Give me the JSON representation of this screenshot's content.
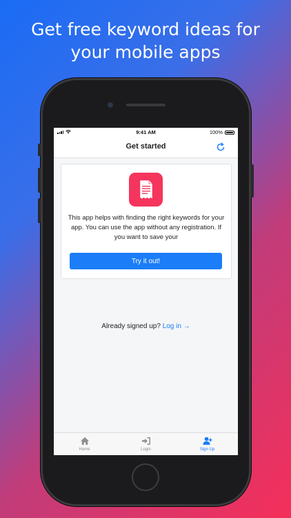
{
  "headline": {
    "line1": "Get free keyword ideas for",
    "line2": "your mobile apps"
  },
  "status_bar": {
    "time": "9:41 AM",
    "battery": "100%"
  },
  "nav": {
    "title": "Get started",
    "right_icon": "refresh-icon"
  },
  "card": {
    "icon": "document-icon",
    "text": "This app helps with finding the right keywords for your app. You can use the app without any registration. If you want to save your",
    "button_label": "Try it out!"
  },
  "signup_prompt": {
    "text": "Already signed up?",
    "link": "Log in →"
  },
  "tabs": [
    {
      "label": "Home",
      "icon": "home-icon",
      "active": false
    },
    {
      "label": "Login",
      "icon": "login-icon",
      "active": false
    },
    {
      "label": "Sign Up",
      "icon": "user-plus-icon",
      "active": true
    }
  ],
  "colors": {
    "accent": "#1b7df7",
    "app_icon": "#f5355d",
    "background_start": "#1a6cf5",
    "background_end": "#f52f5a"
  }
}
